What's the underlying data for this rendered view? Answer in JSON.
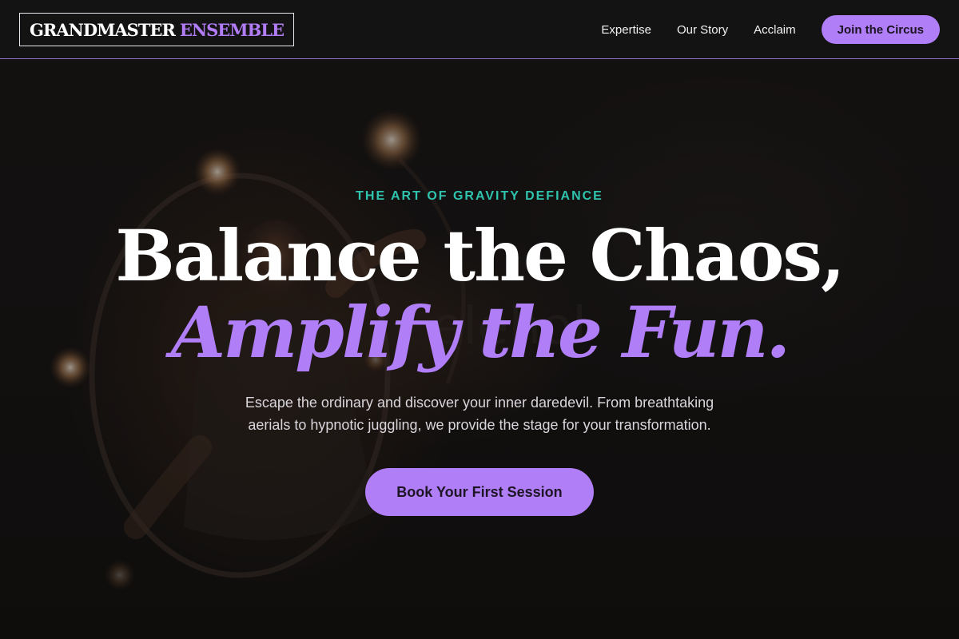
{
  "colors": {
    "accent": "#b07ef6",
    "kicker": "#2fc4ae",
    "background": "#121110",
    "text": "#ffffff"
  },
  "header": {
    "logo": {
      "word1": "GRANDMASTER",
      "word2": "ENSEMBLE"
    },
    "nav": [
      {
        "label": "Expertise"
      },
      {
        "label": "Our Story"
      },
      {
        "label": "Acclaim"
      }
    ],
    "cta_label": "Join the Circus"
  },
  "hero": {
    "background_image": "fire-hoop-performer-photo",
    "kicker": "THE ART OF GRAVITY DEFIANCE",
    "headline_line1": "Balance the Chaos,",
    "headline_line2": "Amplify the Fun.",
    "lede": "Escape the ordinary and discover your inner daredevil. From breathtaking aerials to hypnotic juggling, we provide the stage for your transformation.",
    "button_label": "Book Your First Session"
  }
}
